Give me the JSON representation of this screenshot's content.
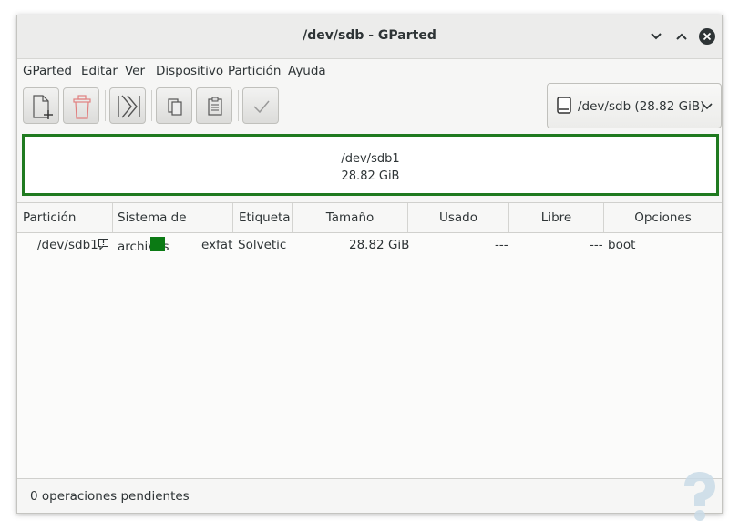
{
  "window": {
    "title": "/dev/sdb - GParted"
  },
  "menu": [
    "GParted",
    "Editar",
    "Ver",
    "Dispositivo",
    "Partición",
    "Ayuda"
  ],
  "toolbar": {
    "buttons": [
      "new-partition-icon",
      "delete-partition-icon",
      "resize-move-icon",
      "copy-icon",
      "paste-icon",
      "apply-icon"
    ]
  },
  "device_selector": {
    "label": "/dev/sdb (28.82 GiB)"
  },
  "disk_map": {
    "name": "/dev/sdb1",
    "size": "28.82 GiB",
    "border_color": "#1f7a1f"
  },
  "table": {
    "headers": [
      "Partición",
      "Sistema de archivos",
      "Etiqueta",
      "Tamaño",
      "Usado",
      "Libre",
      "Opciones"
    ],
    "rows": [
      {
        "partition": "/dev/sdb1",
        "fs_color": "#0b7a14",
        "filesystem": "exfat",
        "label": "Solvetic",
        "size": "28.82 GiB",
        "used": "---",
        "free": "---",
        "flags": "boot"
      }
    ]
  },
  "status": {
    "text": "0 operaciones pendientes"
  }
}
